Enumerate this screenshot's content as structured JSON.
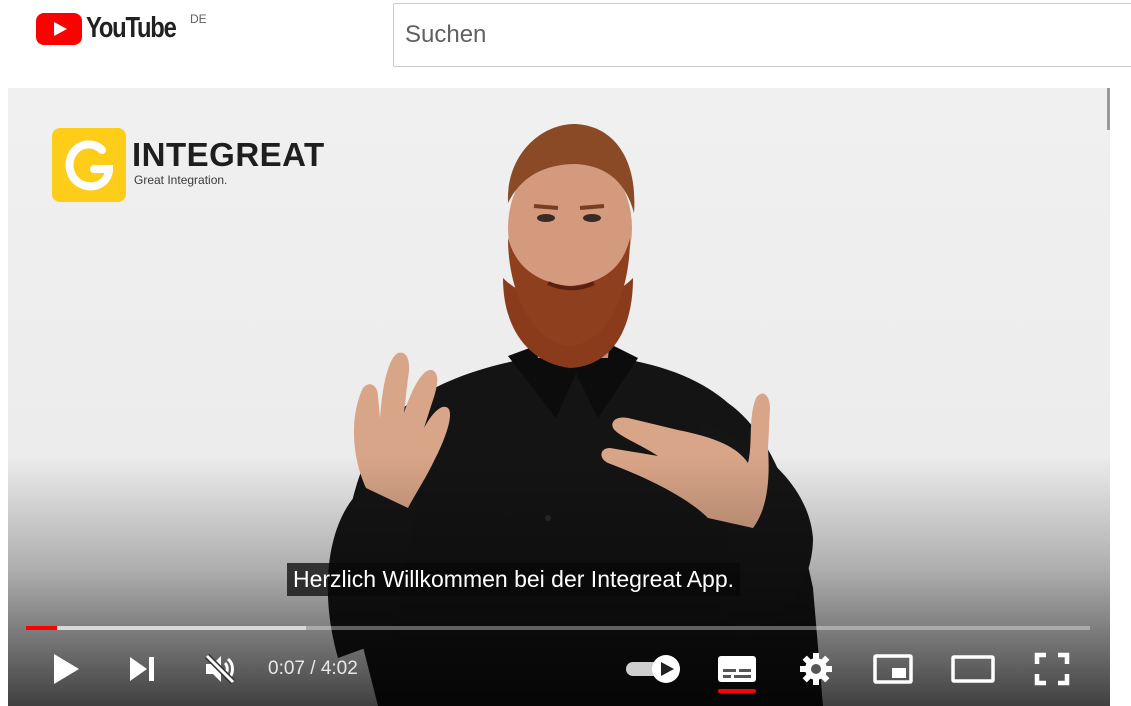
{
  "header": {
    "logo_text": "YouTube",
    "region": "DE",
    "search_placeholder": "Suchen"
  },
  "video": {
    "brand_name": "INTEGREAT",
    "brand_tagline": "Great Integration.",
    "caption": "Herzlich Willkommen bei der Integreat App."
  },
  "player": {
    "current_time": "0:07",
    "duration": "4:02",
    "time_display": "0:07 / 4:02",
    "progress_played_fraction": 0.029,
    "progress_loaded_fraction": 0.263,
    "muted": true,
    "autoplay_enabled": true,
    "subtitles_enabled": true
  },
  "icons": {
    "play": "play-icon",
    "next": "next-icon",
    "mute": "volume-muted-icon",
    "autoplay": "autoplay-toggle-icon",
    "subtitles": "subtitles-icon",
    "settings": "gear-icon",
    "miniplayer": "miniplayer-icon",
    "theater": "theater-mode-icon",
    "fullscreen": "fullscreen-icon"
  },
  "colors": {
    "youtube_red": "#ff0000",
    "brand_yellow": "#fecd1a",
    "text_dark": "#212121"
  }
}
